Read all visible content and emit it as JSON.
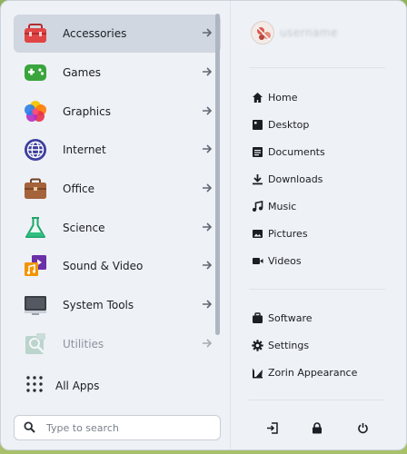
{
  "categories": [
    {
      "label": "Accessories",
      "icon": "toolbox-icon",
      "active": true
    },
    {
      "label": "Games",
      "icon": "gamepad-icon"
    },
    {
      "label": "Graphics",
      "icon": "color-petals-icon"
    },
    {
      "label": "Internet",
      "icon": "globe-icon"
    },
    {
      "label": "Office",
      "icon": "briefcase-icon"
    },
    {
      "label": "Science",
      "icon": "flask-icon"
    },
    {
      "label": "Sound & Video",
      "icon": "media-icon"
    },
    {
      "label": "System Tools",
      "icon": "monitor-icon"
    },
    {
      "label": "Utilities",
      "icon": "utilities-icon",
      "dim": true
    }
  ],
  "all_apps": {
    "label": "All Apps",
    "icon": "grid-dots-icon"
  },
  "search": {
    "placeholder": "Type to search"
  },
  "user": {
    "name": "username"
  },
  "places": [
    {
      "label": "Home",
      "icon": "home-icon"
    },
    {
      "label": "Desktop",
      "icon": "desktop-icon"
    },
    {
      "label": "Documents",
      "icon": "documents-icon"
    },
    {
      "label": "Downloads",
      "icon": "download-icon"
    },
    {
      "label": "Music",
      "icon": "music-icon"
    },
    {
      "label": "Pictures",
      "icon": "pictures-icon"
    },
    {
      "label": "Videos",
      "icon": "videos-icon"
    }
  ],
  "system": [
    {
      "label": "Software",
      "icon": "bag-icon"
    },
    {
      "label": "Settings",
      "icon": "gear-icon"
    },
    {
      "label": "Zorin Appearance",
      "icon": "appearance-icon"
    }
  ],
  "power": [
    {
      "icon": "logout-icon"
    },
    {
      "icon": "lock-icon"
    },
    {
      "icon": "power-icon"
    }
  ],
  "colors": {
    "accent": "#d1d7e0",
    "text": "#1b1e24",
    "panel": "#eef1f6"
  }
}
